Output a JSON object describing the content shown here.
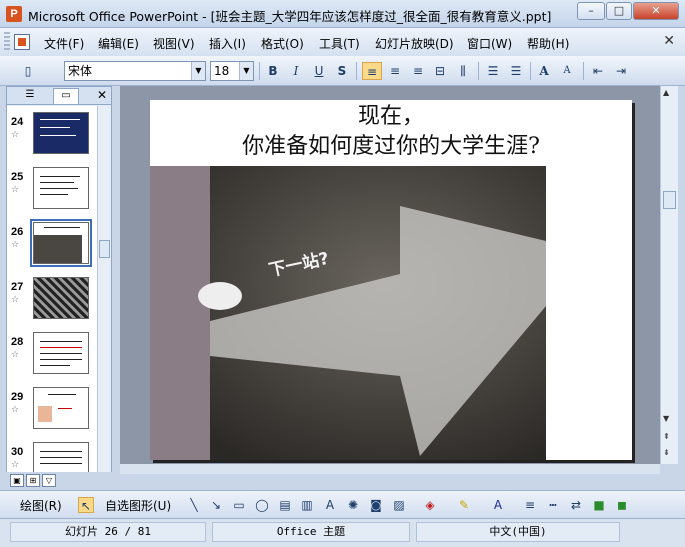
{
  "window": {
    "app_name": "Microsoft Office PowerPoint",
    "title": "Microsoft Office PowerPoint - [班会主题_大学四年应该怎样度过_很全面_很有教育意义.ppt]",
    "minimize": "–",
    "maximize": "□",
    "close": "✕"
  },
  "menu": {
    "items": [
      "文件(F)",
      "编辑(E)",
      "视图(V)",
      "插入(I)",
      "格式(O)",
      "工具(T)",
      "幻灯片放映(D)",
      "窗口(W)",
      "帮助(H)"
    ],
    "close": "✕"
  },
  "toolbar": {
    "font_name": "宋体",
    "font_size": "18",
    "bold": "B",
    "italic": "I",
    "underline": "U",
    "shadow": "S",
    "grow_font": "A",
    "shrink_font": "A"
  },
  "slides_panel": {
    "close": "✕",
    "thumbnails": [
      {
        "number": "24"
      },
      {
        "number": "25"
      },
      {
        "number": "26"
      },
      {
        "number": "27"
      },
      {
        "number": "28"
      },
      {
        "number": "29"
      },
      {
        "number": "30"
      }
    ],
    "selected": "26"
  },
  "slide": {
    "title_line1": "现在，",
    "title_line2": "你准备如何度过你的大学生涯?",
    "photo_text": "下一站?"
  },
  "drawing_toolbar": {
    "draw_menu": "绘图(R)",
    "autoshapes": "自选图形(U)"
  },
  "status": {
    "slide_info": "幻灯片 26 / 81",
    "theme": "Office 主题",
    "language": "中文(中国)"
  }
}
